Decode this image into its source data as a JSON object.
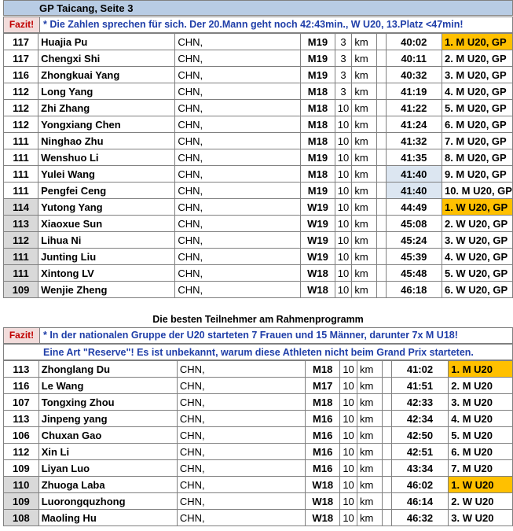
{
  "title": "GP Taicang, Seite 3",
  "fazit_label": "Fazit!",
  "fazit1_text": "* Die Zahlen sprechen für sich. Der 20.Mann geht noch 42:43min., W U20, 13.Platz <47min!",
  "section2_title": "Die besten Teilnehmer am Rahmenprogramm",
  "fazit2_text": "* In der nationalen Gruppe der U20 starteten 7 Frauen und 15 Männer, darunter 7x M U18!",
  "reserve_text": "Eine Art \"Reserve\"! Es ist unbekannt, warum diese Athleten nicht beim Grand Prix starteten.",
  "colors": {
    "title_bg": "#b8cce4",
    "gold": "#ffc000",
    "time_highlight": "#dce6f1",
    "fazit_text": "#1f3ea8",
    "fazit_tag": "#c00000"
  },
  "table1": [
    {
      "nr": "117",
      "name": "Huajia Pu",
      "nat": "CHN,",
      "cls": "M19",
      "dist": "3",
      "unit": "km",
      "time": "40:02",
      "place": "1. M U20, GP"
    },
    {
      "nr": "117",
      "name": "Chengxi Shi",
      "nat": "CHN,",
      "cls": "M19",
      "dist": "3",
      "unit": "km",
      "time": "40:11",
      "place": "2. M U20, GP"
    },
    {
      "nr": "116",
      "name": "Zhongkuai Yang",
      "nat": "CHN,",
      "cls": "M19",
      "dist": "3",
      "unit": "km",
      "time": "40:32",
      "place": "3. M U20, GP"
    },
    {
      "nr": "112",
      "name": "Long Yang",
      "nat": "CHN,",
      "cls": "M18",
      "dist": "3",
      "unit": "km",
      "time": "41:19",
      "place": "4. M U20, GP"
    },
    {
      "nr": "112",
      "name": "Zhi Zhang",
      "nat": "CHN,",
      "cls": "M18",
      "dist": "10",
      "unit": "km",
      "time": "41:22",
      "place": "5. M U20, GP"
    },
    {
      "nr": "112",
      "name": "Yongxiang Chen",
      "nat": "CHN,",
      "cls": "M18",
      "dist": "10",
      "unit": "km",
      "time": "41:24",
      "place": "6. M U20, GP"
    },
    {
      "nr": "111",
      "name": "Ninghao Zhu",
      "nat": "CHN,",
      "cls": "M18",
      "dist": "10",
      "unit": "km",
      "time": "41:32",
      "place": "7. M U20, GP"
    },
    {
      "nr": "111",
      "name": "Wenshuo Li",
      "nat": "CHN,",
      "cls": "M19",
      "dist": "10",
      "unit": "km",
      "time": "41:35",
      "place": "8. M U20, GP"
    },
    {
      "nr": "111",
      "name": "Yulei Wang",
      "nat": "CHN,",
      "cls": "M18",
      "dist": "10",
      "unit": "km",
      "time": "41:40",
      "place": "9. M U20, GP"
    },
    {
      "nr": "111",
      "name": "Pengfei Ceng",
      "nat": "CHN,",
      "cls": "M19",
      "dist": "10",
      "unit": "km",
      "time": "41:40",
      "place": "10. M U20, GP"
    },
    {
      "nr": "114",
      "name": "Yutong Yang",
      "nat": "CHN,",
      "cls": "W19",
      "dist": "10",
      "unit": "km",
      "time": "44:49",
      "place": "1. W U20, GP"
    },
    {
      "nr": "113",
      "name": "Xiaoxue Sun",
      "nat": "CHN,",
      "cls": "W19",
      "dist": "10",
      "unit": "km",
      "time": "45:08",
      "place": "2. W U20, GP"
    },
    {
      "nr": "112",
      "name": "Lihua Ni",
      "nat": "CHN,",
      "cls": "W19",
      "dist": "10",
      "unit": "km",
      "time": "45:24",
      "place": "3. W U20, GP"
    },
    {
      "nr": "111",
      "name": "Junting Liu",
      "nat": "CHN,",
      "cls": "W19",
      "dist": "10",
      "unit": "km",
      "time": "45:39",
      "place": "4. W U20, GP"
    },
    {
      "nr": "111",
      "name": "Xintong LV",
      "nat": "CHN,",
      "cls": "W18",
      "dist": "10",
      "unit": "km",
      "time": "45:48",
      "place": "5. W U20, GP"
    },
    {
      "nr": "109",
      "name": "Wenjie Zheng",
      "nat": "CHN,",
      "cls": "W18",
      "dist": "10",
      "unit": "km",
      "time": "46:18",
      "place": "6. W U20, GP"
    }
  ],
  "table2": [
    {
      "nr": "113",
      "name": "Zhonglang Du",
      "nat": "CHN,",
      "cls": "M18",
      "dist": "10",
      "unit": "km",
      "time": "41:02",
      "place": "1. M U20"
    },
    {
      "nr": "116",
      "name": "Le Wang",
      "nat": "CHN,",
      "cls": "M17",
      "dist": "10",
      "unit": "km",
      "time": "41:51",
      "place": "2. M U20"
    },
    {
      "nr": "107",
      "name": "Tongxing Zhou",
      "nat": "CHN,",
      "cls": "M18",
      "dist": "10",
      "unit": "km",
      "time": "42:33",
      "place": "3. M U20"
    },
    {
      "nr": "113",
      "name": "Jinpeng yang",
      "nat": "CHN,",
      "cls": "M16",
      "dist": "10",
      "unit": "km",
      "time": "42:34",
      "place": "4. M U20"
    },
    {
      "nr": "106",
      "name": "Chuxan Gao",
      "nat": "CHN,",
      "cls": "M16",
      "dist": "10",
      "unit": "km",
      "time": "42:50",
      "place": "5. M U20"
    },
    {
      "nr": "112",
      "name": "Xin Li",
      "nat": "CHN,",
      "cls": "M16",
      "dist": "10",
      "unit": "km",
      "time": "42:51",
      "place": "6. M U20"
    },
    {
      "nr": "109",
      "name": "Liyan Luo",
      "nat": "CHN,",
      "cls": "M16",
      "dist": "10",
      "unit": "km",
      "time": "43:34",
      "place": "7. M U20"
    },
    {
      "nr": "110",
      "name": "Zhuoga Laba",
      "nat": "CHN,",
      "cls": "W18",
      "dist": "10",
      "unit": "km",
      "time": "46:02",
      "place": "1. W U20"
    },
    {
      "nr": "109",
      "name": "Luorongquzhong",
      "nat": "CHN,",
      "cls": "W18",
      "dist": "10",
      "unit": "km",
      "time": "46:14",
      "place": "2. W U20"
    },
    {
      "nr": "108",
      "name": "Maoling Hu",
      "nat": "CHN,",
      "cls": "W18",
      "dist": "10",
      "unit": "km",
      "time": "46:32",
      "place": "3. W U20"
    }
  ]
}
